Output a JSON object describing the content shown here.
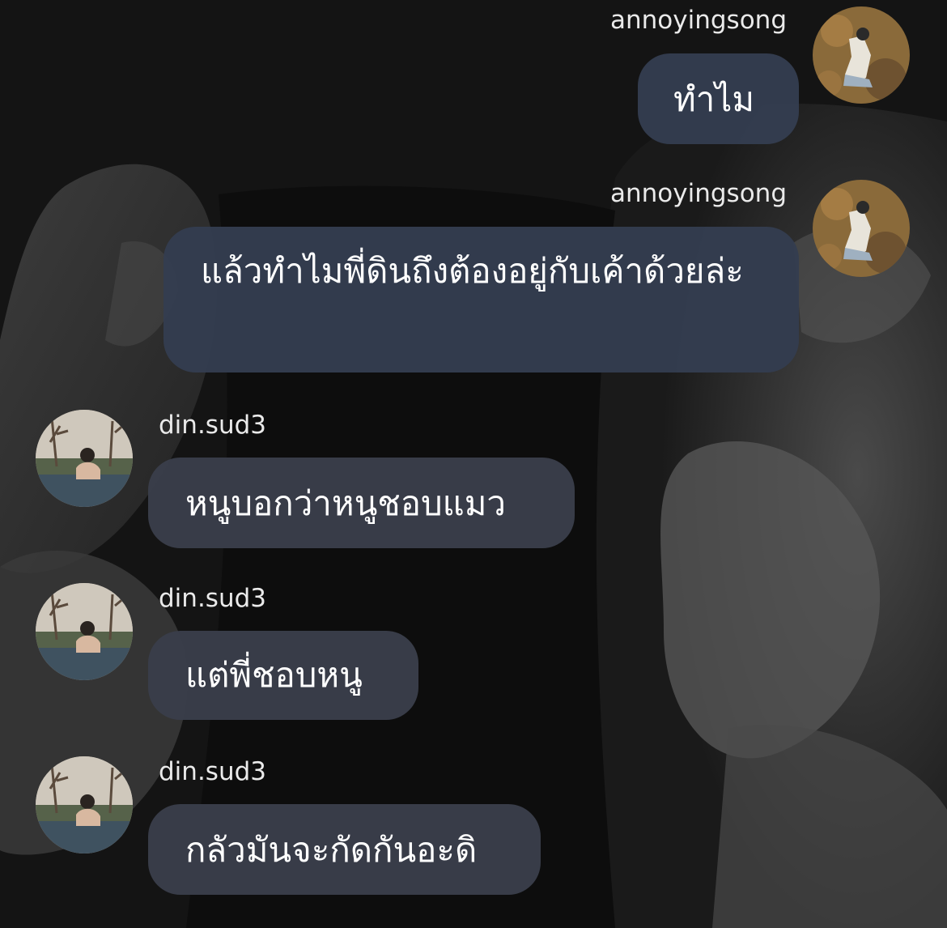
{
  "chat": {
    "messages": [
      {
        "sender": "annoyingsong",
        "text": "ทำไม",
        "direction": "outgoing",
        "avatar": "avatar-annoyingsong"
      },
      {
        "sender": "annoyingsong",
        "text": "แล้วทำไมพี่ดินถึงต้องอยู่กับเค้าด้วยล่ะ",
        "direction": "outgoing",
        "avatar": "avatar-annoyingsong"
      },
      {
        "sender": "din.sud3",
        "text": "หนูบอกว่าหนูชอบแมว",
        "direction": "incoming",
        "avatar": "avatar-din-sud3"
      },
      {
        "sender": "din.sud3",
        "text": "แต่พี่ชอบหนู",
        "direction": "incoming",
        "avatar": "avatar-din-sud3"
      },
      {
        "sender": "din.sud3",
        "text": "กลัวมันจะกัดกันอะดิ",
        "direction": "incoming",
        "avatar": "avatar-din-sud3"
      }
    ]
  },
  "colors": {
    "outgoing_bubble": "#343d50",
    "incoming_bubble": "#3a3e4a",
    "bubble_text": "#ffffff",
    "sender_name_text": "#eaeaea"
  }
}
